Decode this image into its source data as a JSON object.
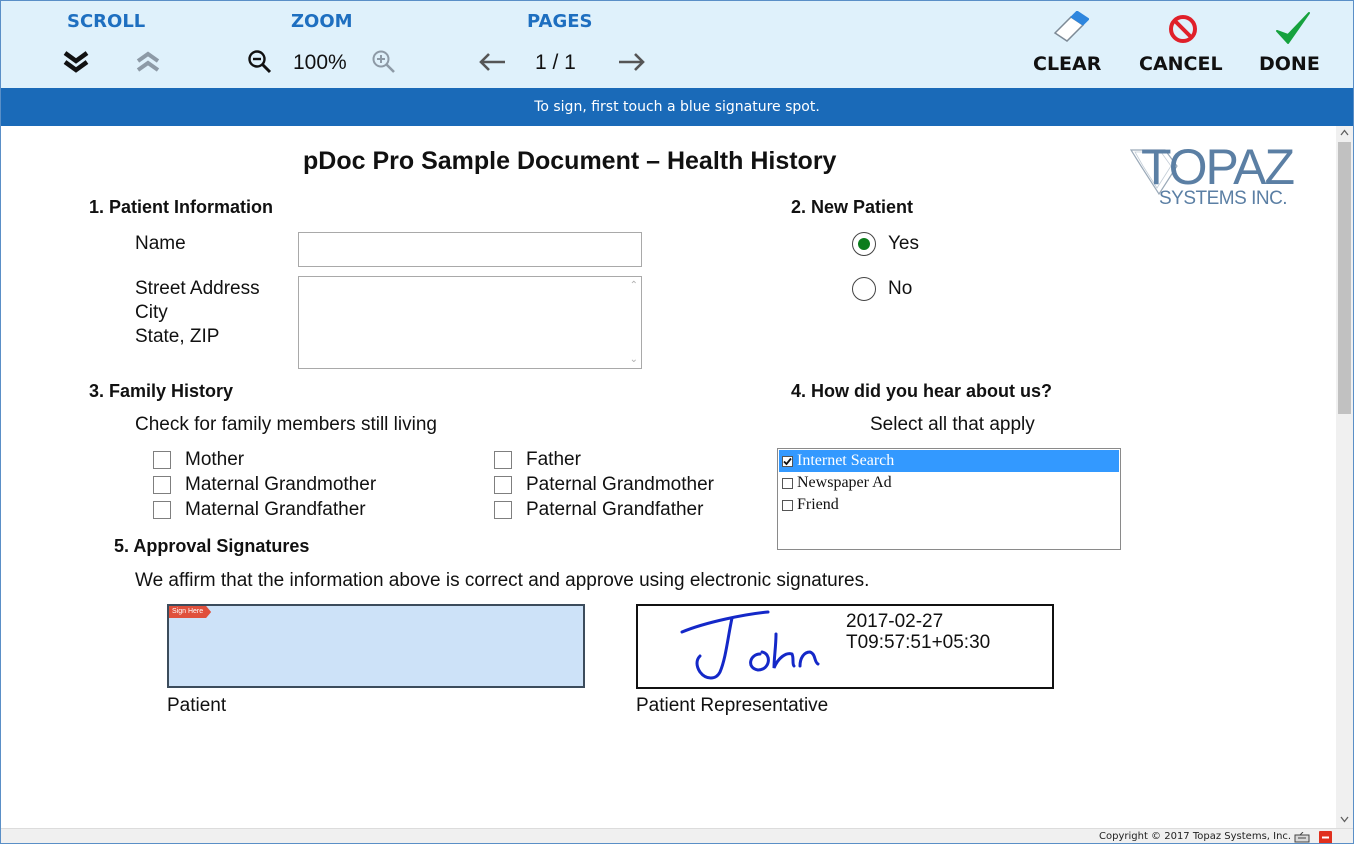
{
  "toolbar": {
    "scroll": {
      "heading": "SCROLL",
      "down_icon": "double-chevron-down-icon",
      "up_icon": "double-chevron-up-icon"
    },
    "zoom": {
      "heading": "ZOOM",
      "level": "100%",
      "out_icon": "zoom-out-icon",
      "in_icon": "zoom-in-icon"
    },
    "pages": {
      "heading": "PAGES",
      "indicator": "1 / 1",
      "prev_icon": "arrow-left-icon",
      "next_icon": "arrow-right-icon"
    },
    "actions": {
      "clear": {
        "label": "CLEAR",
        "icon": "eraser-icon"
      },
      "cancel": {
        "label": "CANCEL",
        "icon": "no-sign-icon"
      },
      "done": {
        "label": "DONE",
        "icon": "checkmark-icon"
      }
    },
    "colors": {
      "heading": "#1e6fc0",
      "background": "#dff1fb",
      "cancel": "#e0202a",
      "done": "#16a23e"
    }
  },
  "instruction": "To sign, first touch a blue signature spot.",
  "document": {
    "title": "pDoc Pro Sample Document – Health History",
    "logo": {
      "main": "TOPAZ",
      "sub": "SYSTEMS INC."
    },
    "patient_info": {
      "heading": "1.  Patient Information",
      "name_label": "Name",
      "name_value": "",
      "address_labels": [
        "Street Address",
        "City",
        "State, ZIP"
      ],
      "address_value": ""
    },
    "new_patient": {
      "heading": "2.  New Patient",
      "options": [
        {
          "label": "Yes",
          "selected": true
        },
        {
          "label": "No",
          "selected": false
        }
      ]
    },
    "family_history": {
      "heading": "3.  Family History",
      "instruction": "Check for family members still living",
      "members": [
        {
          "label": "Mother",
          "checked": false
        },
        {
          "label": "Maternal Grandmother",
          "checked": false
        },
        {
          "label": "Maternal Grandfather",
          "checked": false
        },
        {
          "label": "Father",
          "checked": false
        },
        {
          "label": "Paternal Grandmother",
          "checked": false
        },
        {
          "label": "Paternal Grandfather",
          "checked": false
        }
      ]
    },
    "referral": {
      "heading": "4.  How did you hear about us?",
      "instruction": "Select all that apply",
      "options": [
        {
          "label": "Internet Search",
          "checked": true,
          "highlighted": true
        },
        {
          "label": "Newspaper Ad",
          "checked": false,
          "highlighted": false
        },
        {
          "label": "Friend",
          "checked": false,
          "highlighted": false
        }
      ]
    },
    "signatures": {
      "heading": "5.  Approval Signatures",
      "statement": "We affirm that the information above is correct and approve using electronic signatures.",
      "patient": {
        "label": "Patient",
        "sign_here": "Sign Here",
        "signed": false
      },
      "representative": {
        "label": "Patient Representative",
        "signed": true,
        "signature_text": "John",
        "date": "2017-02-27",
        "time": "T09:57:51+05:30"
      }
    }
  },
  "status_bar": {
    "copyright": "Copyright © 2017 Topaz Systems, Inc.",
    "keyboard_icon": "keyboard-icon",
    "minimize_icon": "minimize-icon"
  }
}
